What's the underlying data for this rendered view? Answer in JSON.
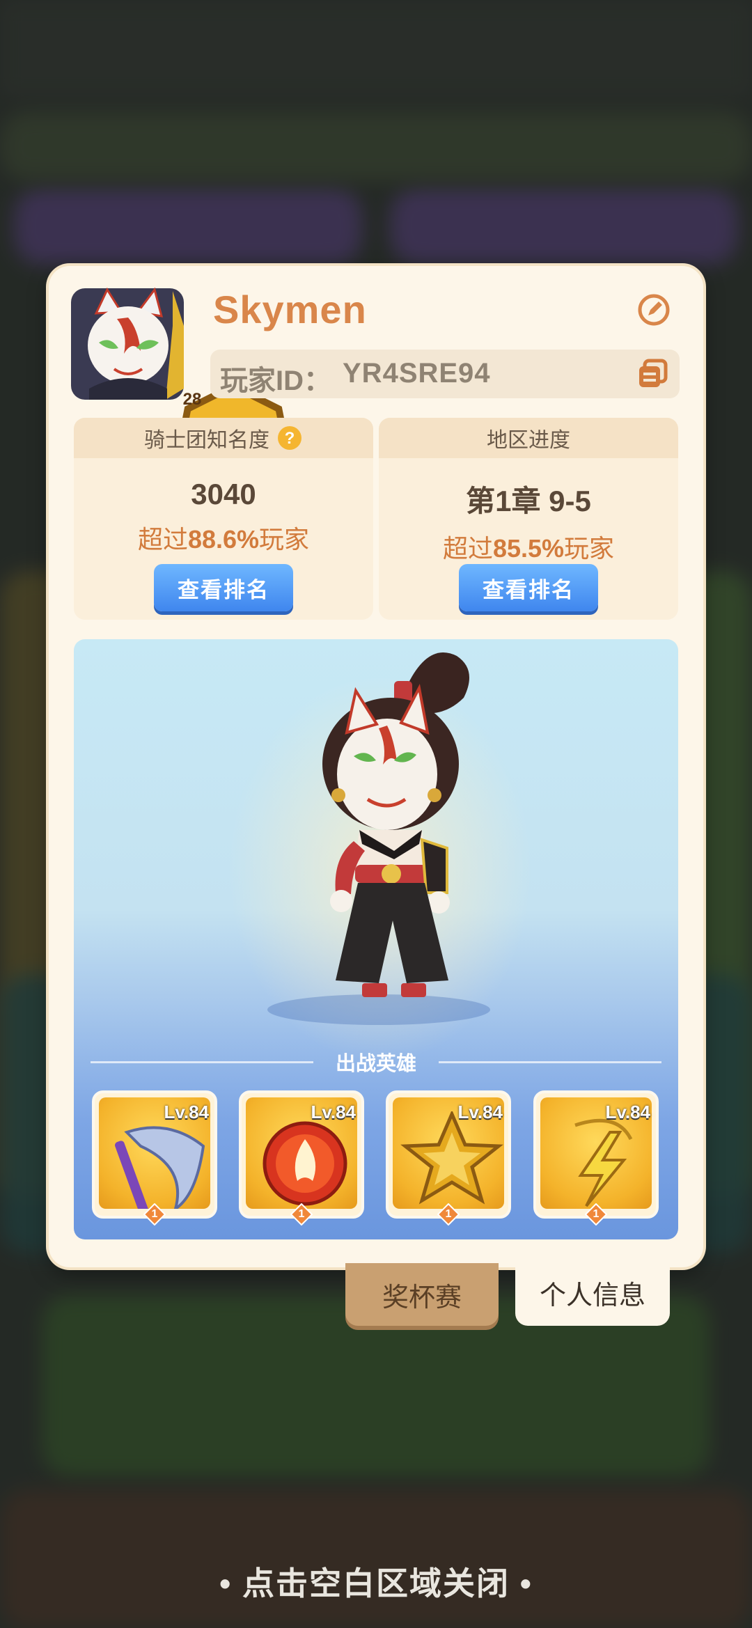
{
  "player": {
    "name": "Skymen",
    "id_label": "玩家ID：",
    "id_value": "YR4SRE94",
    "level": "28"
  },
  "stats": {
    "fame": {
      "title": "骑士团知名度",
      "value": "3040",
      "exceed_prefix": "超过",
      "exceed_pct": "88.6%",
      "exceed_suffix": "玩家",
      "button": "查看排名"
    },
    "region": {
      "title": "地区进度",
      "value": "第1章 9-5",
      "exceed_prefix": "超过",
      "exceed_pct": "85.5%",
      "exceed_suffix": "玩家",
      "button": "查看排名"
    }
  },
  "heroes": {
    "title": "出战英雄",
    "items": [
      {
        "level": "Lv.84",
        "stars": "1",
        "icon": "scythe-icon"
      },
      {
        "level": "Lv.84",
        "stars": "1",
        "icon": "fire-orb-icon"
      },
      {
        "level": "Lv.84",
        "stars": "1",
        "icon": "gold-star-emblem-icon"
      },
      {
        "level": "Lv.84",
        "stars": "1",
        "icon": "lightning-pendant-icon"
      }
    ]
  },
  "tabs": {
    "trophy": "奖杯赛",
    "profile": "个人信息"
  },
  "hint": "• 点击空白区域关闭 •",
  "colors": {
    "name": "#d9864a",
    "accent_orange": "#d27b3c",
    "button_blue": "#3f86ee",
    "panel": "#fdf6e9"
  }
}
